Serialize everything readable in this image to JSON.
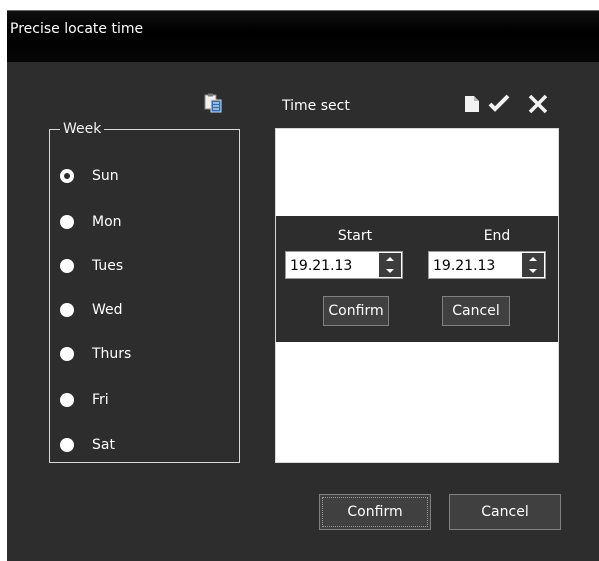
{
  "window": {
    "title": "Precise locate time"
  },
  "week": {
    "legend": "Week",
    "selected": "Sun",
    "days": [
      "Sun",
      "Mon",
      "Tues",
      "Wed",
      "Thurs",
      "Fri",
      "Sat"
    ]
  },
  "time_section": {
    "label": "Time sect",
    "toolbar_icons": [
      "clipboard-icon",
      "new-document-icon",
      "checkmark-icon",
      "close-icon"
    ],
    "editor": {
      "start_label": "Start",
      "end_label": "End",
      "start_value": "19.21.13",
      "end_value": "19.21.13",
      "confirm_label": "Confirm",
      "cancel_label": "Cancel"
    }
  },
  "footer": {
    "confirm_label": "Confirm",
    "cancel_label": "Cancel"
  },
  "colors": {
    "dialog_bg": "#2d2d2d",
    "titlebar_bg": "#000000",
    "text": "#ffffff",
    "panel_bg": "#ffffff"
  }
}
